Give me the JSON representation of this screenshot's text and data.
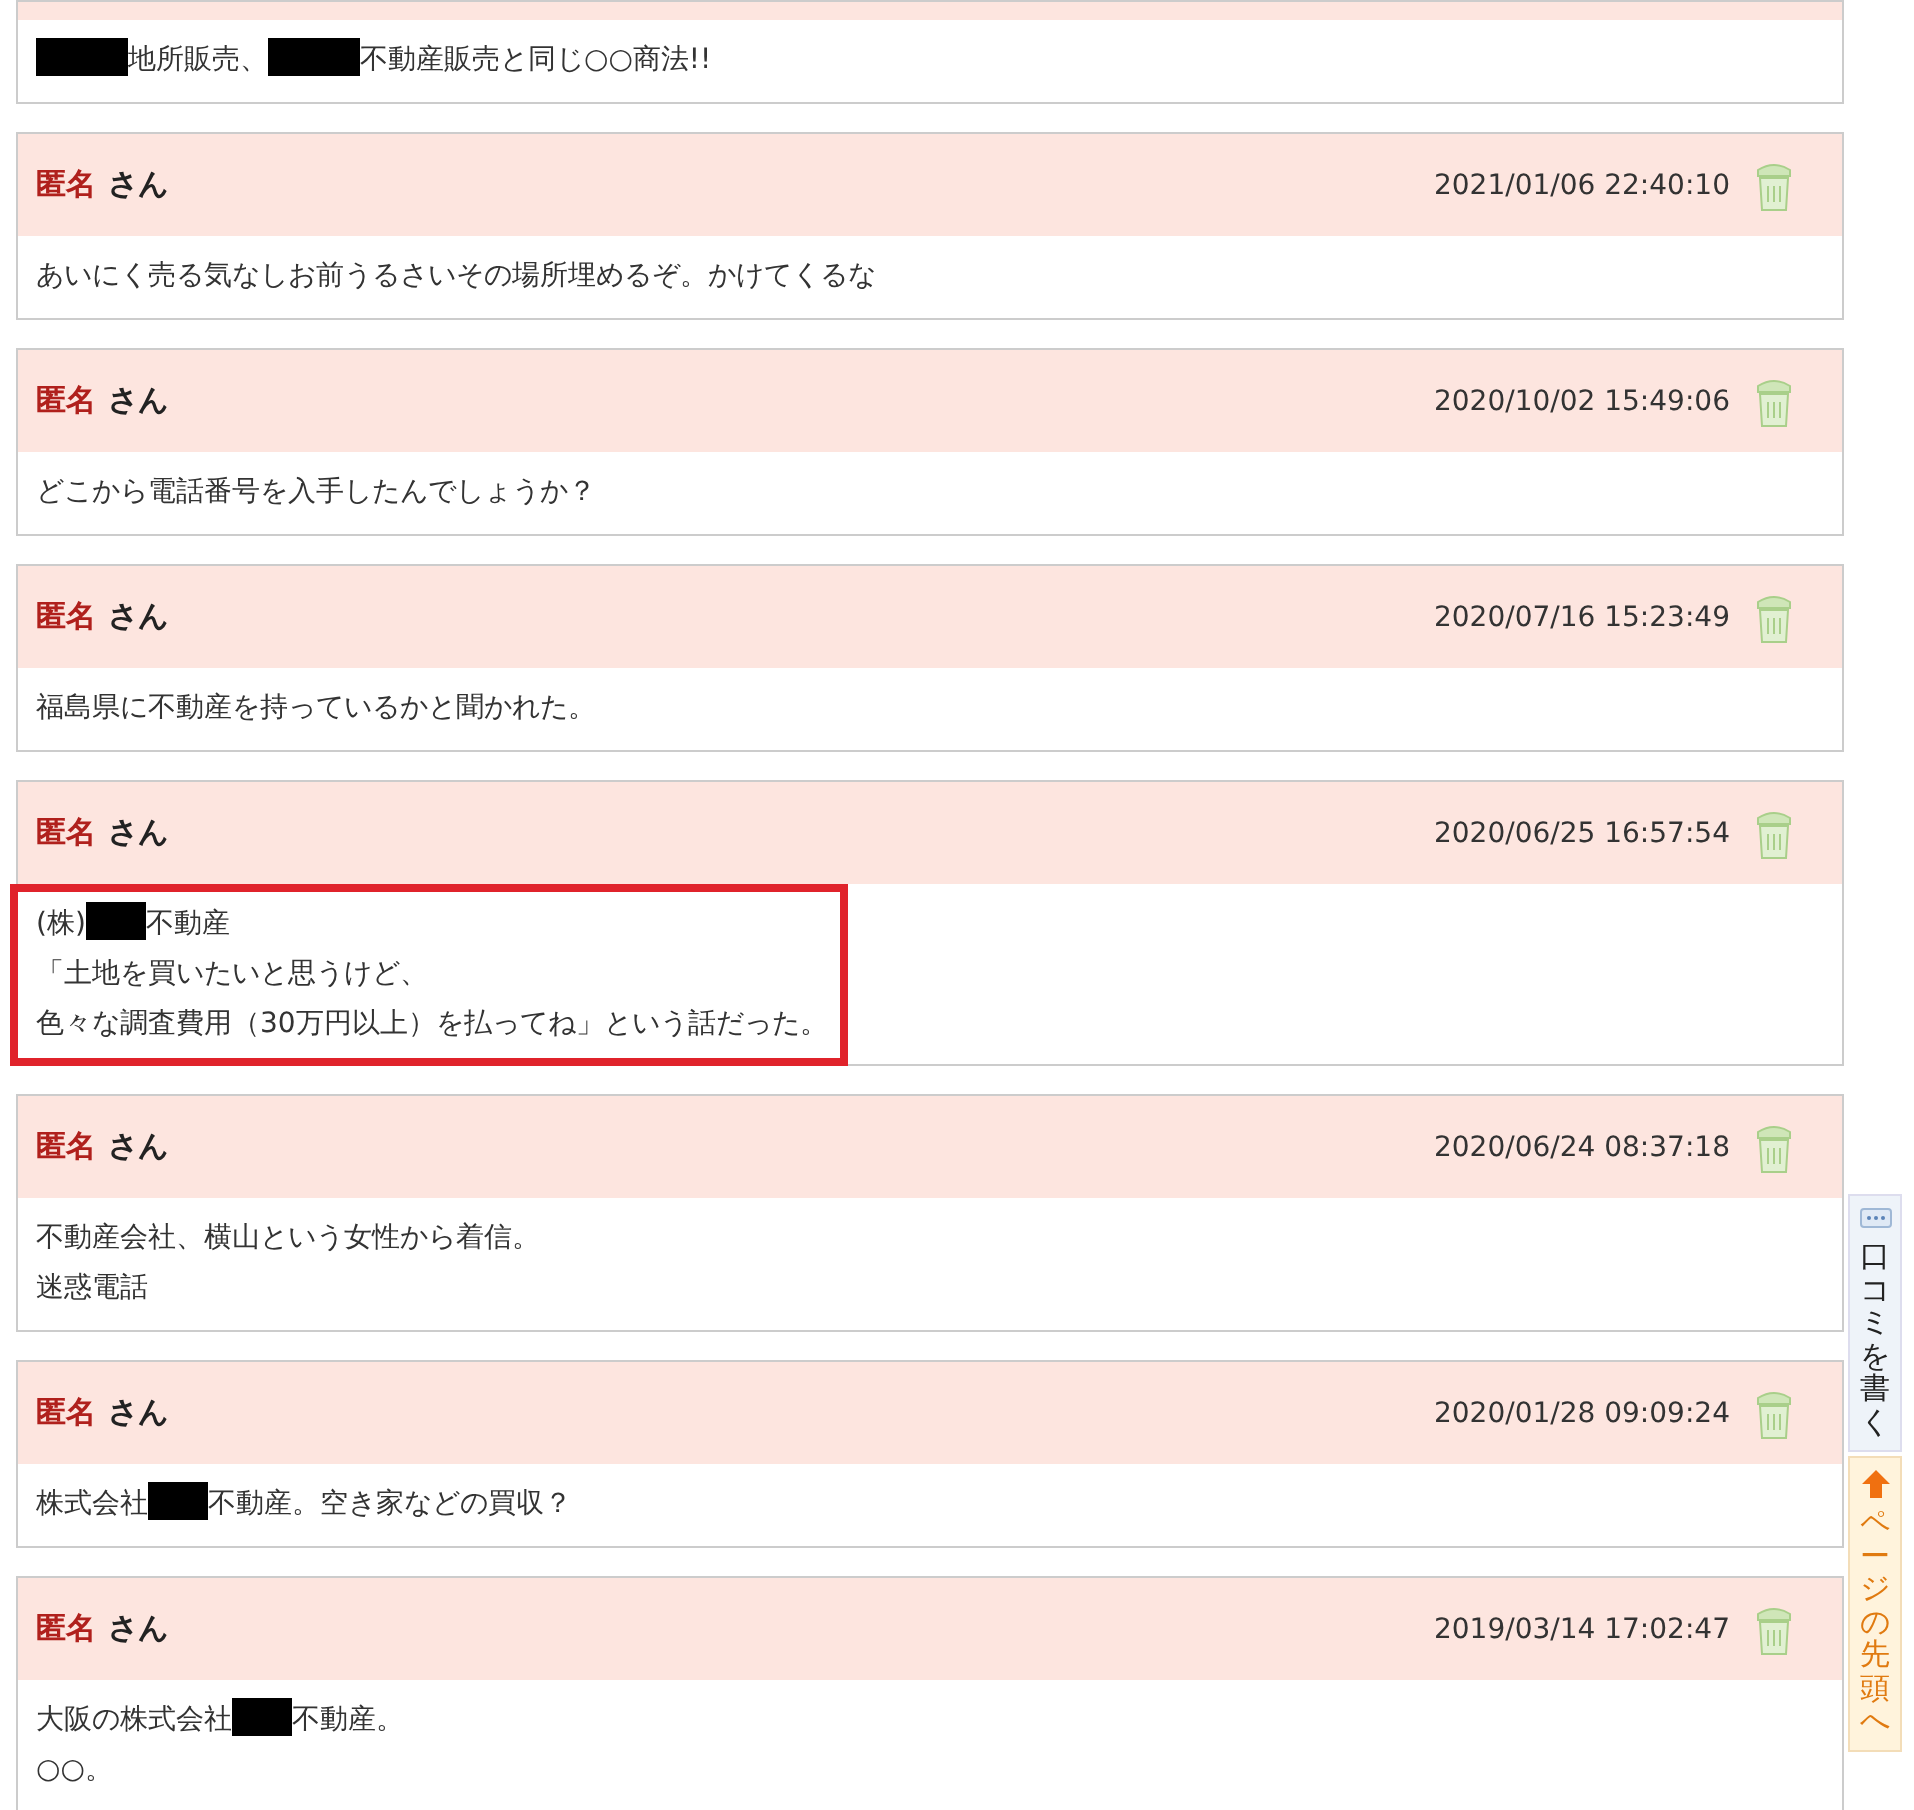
{
  "comments": [
    {
      "lines": [
        [
          {
            "kind": "redacted_wide"
          },
          {
            "kind": "text",
            "text": "地所販売、"
          },
          {
            "kind": "redacted_wide"
          },
          {
            "kind": "text",
            "text": "不動産販売と同じ○○商法!!"
          }
        ]
      ],
      "highlighted": false
    },
    {
      "author": "匿名",
      "suffix": "さん",
      "date": "2021/01/06 22:40:10",
      "lines": [
        [
          {
            "kind": "text",
            "text": "あいにく売る気なしお前うるさいその場所埋めるぞ。かけてくるな"
          }
        ]
      ],
      "highlighted": false
    },
    {
      "author": "匿名",
      "suffix": "さん",
      "date": "2020/10/02 15:49:06",
      "lines": [
        [
          {
            "kind": "text",
            "text": "どこから電話番号を入手したんでしょうか？"
          }
        ]
      ],
      "highlighted": false
    },
    {
      "author": "匿名",
      "suffix": "さん",
      "date": "2020/07/16 15:23:49",
      "lines": [
        [
          {
            "kind": "text",
            "text": "福島県に不動産を持っているかと聞かれた。"
          }
        ]
      ],
      "highlighted": false
    },
    {
      "author": "匿名",
      "suffix": "さん",
      "date": "2020/06/25 16:57:54",
      "lines": [
        [
          {
            "kind": "text",
            "text": "(株)"
          },
          {
            "kind": "redacted"
          },
          {
            "kind": "text",
            "text": "不動産"
          }
        ],
        [
          {
            "kind": "text",
            "text": "「土地を買いたいと思うけど、"
          }
        ],
        [
          {
            "kind": "text",
            "text": "色々な調査費用（30万円以上）を払ってね」という話だった。"
          }
        ]
      ],
      "highlighted": true
    },
    {
      "author": "匿名",
      "suffix": "さん",
      "date": "2020/06/24 08:37:18",
      "lines": [
        [
          {
            "kind": "text",
            "text": "不動産会社、横山という女性から着信。"
          }
        ],
        [
          {
            "kind": "text",
            "text": "迷惑電話"
          }
        ]
      ],
      "highlighted": false
    },
    {
      "author": "匿名",
      "suffix": "さん",
      "date": "2020/01/28 09:09:24",
      "lines": [
        [
          {
            "kind": "text",
            "text": "株式会社"
          },
          {
            "kind": "redacted"
          },
          {
            "kind": "text",
            "text": "不動産。空き家などの買収？"
          }
        ]
      ],
      "highlighted": false
    },
    {
      "author": "匿名",
      "suffix": "さん",
      "date": "2019/03/14 17:02:47",
      "lines": [
        [
          {
            "kind": "text",
            "text": "大阪の株式会社"
          },
          {
            "kind": "redacted"
          },
          {
            "kind": "text",
            "text": "不動産。"
          }
        ],
        [
          {
            "kind": "text",
            "text": "○○。"
          }
        ]
      ],
      "highlighted": false
    }
  ],
  "side_tabs": [
    {
      "kind": "review",
      "label": "口コミを書く"
    },
    {
      "kind": "top",
      "label": "ページの先頭へ"
    }
  ]
}
